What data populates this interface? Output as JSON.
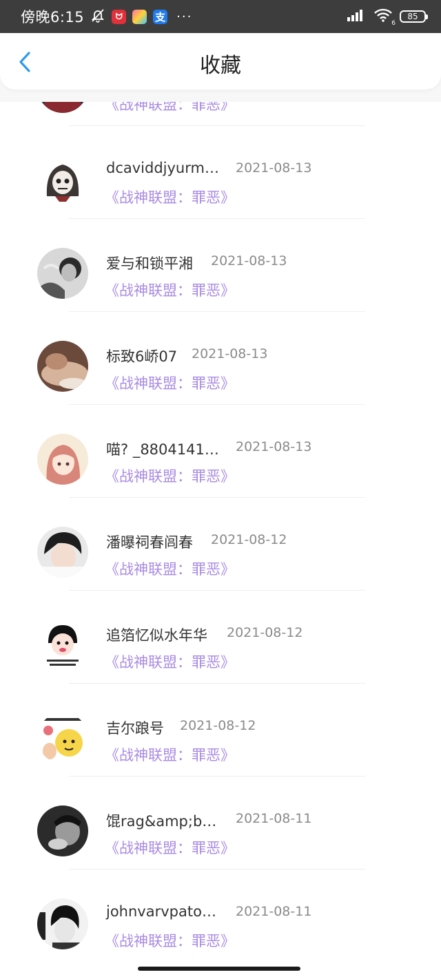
{
  "status_bar": {
    "time": "傍晚6:15",
    "app_icons": [
      "notification-muted-icon",
      "app-red-icon",
      "app-gallery-icon",
      "alipay-icon"
    ],
    "more": "···",
    "battery": "85",
    "wifi_badge": "6"
  },
  "header": {
    "title": "收藏"
  },
  "items": [
    {
      "name": "",
      "date": "",
      "title": "《战神联盟：罪恶》"
    },
    {
      "name": "dcaviddjyurm…",
      "date": "2021-08-13",
      "title": "《战神联盟：罪恶》"
    },
    {
      "name": "爱与和锁平湘",
      "date": "2021-08-13",
      "title": "《战神联盟：罪恶》"
    },
    {
      "name": "标致6峤07",
      "date": "2021-08-13",
      "title": "《战神联盟：罪恶》"
    },
    {
      "name": "喵? _8804141…",
      "date": "2021-08-13",
      "title": "《战神联盟：罪恶》"
    },
    {
      "name": "潘曝祠春闾春",
      "date": "2021-08-12",
      "title": "《战神联盟：罪恶》"
    },
    {
      "name": "追箔忆似水年华",
      "date": "2021-08-12",
      "title": "《战神联盟：罪恶》"
    },
    {
      "name": "吉尔踉号",
      "date": "2021-08-12",
      "title": "《战神联盟：罪恶》"
    },
    {
      "name": "馄rag&amp;b…",
      "date": "2021-08-11",
      "title": "《战神联盟：罪恶》"
    },
    {
      "name": "johnvarvpato…",
      "date": "2021-08-11",
      "title": "《战神联盟：罪恶》"
    }
  ],
  "colors": {
    "accent": "#a98be3",
    "back": "#2f9be8",
    "status_bg": "#3d3d3d"
  }
}
